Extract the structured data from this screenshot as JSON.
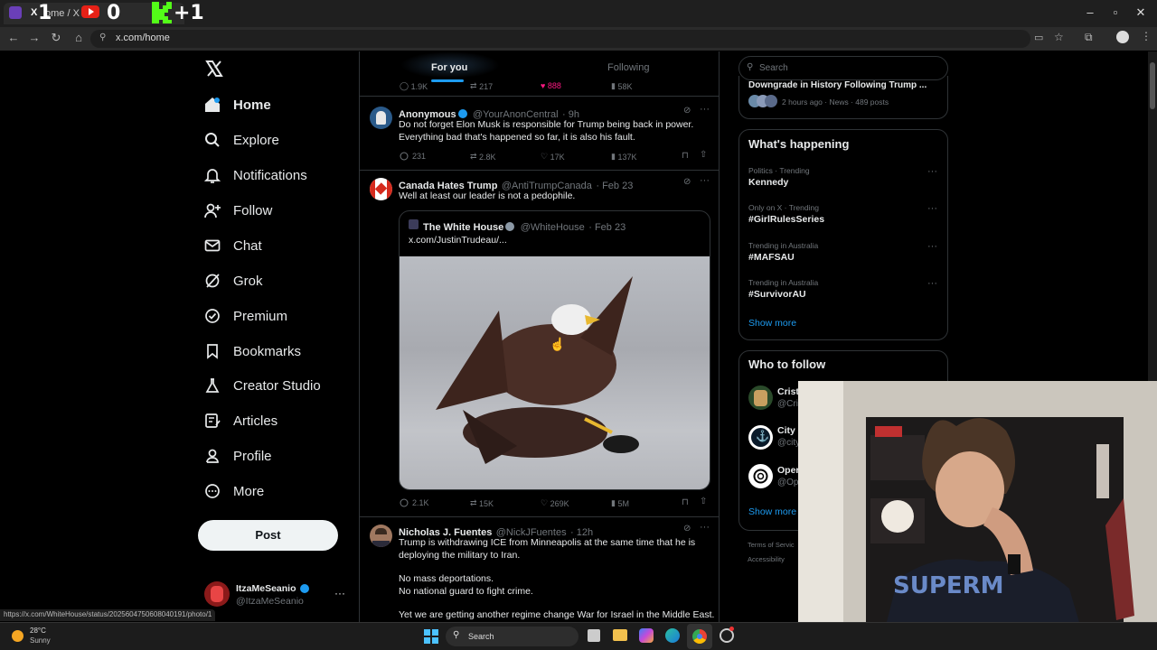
{
  "browser": {
    "tab_title": "ome / X",
    "scores": [
      "1",
      "0",
      "+1"
    ],
    "url": "x.com/home",
    "status_url": "https://x.com/WhiteHouse/status/2025604750608040191/photo/1"
  },
  "nav": {
    "items": [
      {
        "label": "Home",
        "icon": "home-icon"
      },
      {
        "label": "Explore",
        "icon": "search-icon"
      },
      {
        "label": "Notifications",
        "icon": "bell-icon"
      },
      {
        "label": "Follow",
        "icon": "person-plus-icon"
      },
      {
        "label": "Chat",
        "icon": "mail-icon"
      },
      {
        "label": "Grok",
        "icon": "grok-icon"
      },
      {
        "label": "Premium",
        "icon": "verified-badge-icon"
      },
      {
        "label": "Bookmarks",
        "icon": "bookmark-icon"
      },
      {
        "label": "Creator Studio",
        "icon": "flask-icon"
      },
      {
        "label": "Articles",
        "icon": "article-icon"
      },
      {
        "label": "Profile",
        "icon": "person-icon"
      },
      {
        "label": "More",
        "icon": "more-circle-icon"
      }
    ],
    "post_label": "Post",
    "account": {
      "name": "ItzaMeSeanio",
      "handle": "@ItzaMeSeanio"
    }
  },
  "feed": {
    "tabs": [
      "For you",
      "Following"
    ],
    "prev_actions": [
      "1.9K",
      "217",
      "888",
      "58K"
    ],
    "tweets": [
      {
        "name": "Anonymous",
        "handle": "@YourAnonCentral",
        "time": "· 9h",
        "text1": "Do not forget Elon Musk is responsible for Trump being back in power.",
        "text2": "Everything bad that's happened so far, it is also his fault.",
        "replies": "231",
        "reposts": "2.8K",
        "likes": "17K",
        "views": "137K"
      },
      {
        "name": "Canada Hates Trump",
        "handle": "@AntiTrumpCanada",
        "time": "· Feb 23",
        "text1": "Well at least our leader is not a pedophile.",
        "quote": {
          "name": "The White House",
          "handle": "@WhiteHouse",
          "time": "· Feb 23",
          "text": "x.com/JustinTrudeau/..."
        },
        "replies": "2.1K",
        "reposts": "15K",
        "likes": "269K",
        "views": "5M"
      },
      {
        "name": "Nicholas J. Fuentes",
        "handle": "@NickJFuentes",
        "time": "· 12h",
        "text1": "Trump is withdrawing ICE from Minneapolis at the same time that he is",
        "text2": "deploying the military to Iran.",
        "text3": "No mass deportations.",
        "text4": "No national guard to fight crime.",
        "text5": "Yet we are getting another regime change War for Israel in the Middle East."
      }
    ]
  },
  "right": {
    "search_placeholder": "Search",
    "news_title": "Downgrade in History Following Trump ...",
    "news_meta": "2 hours ago · News · 489 posts",
    "happening_title": "What's happening",
    "trends": [
      {
        "meta": "Politics · Trending",
        "name": "Kennedy"
      },
      {
        "meta": "Only on X · Trending",
        "name": "#GirlRulesSeries"
      },
      {
        "meta": "Trending in Australia",
        "name": "#MAFSAU"
      },
      {
        "meta": "Trending in Australia",
        "name": "#SurvivorAU"
      }
    ],
    "show_more": "Show more",
    "who_title": "Who to follow",
    "follow": [
      {
        "name": "Crist",
        "handle": "@Cri"
      },
      {
        "name": "City",
        "handle": "@city"
      },
      {
        "name": "Oper",
        "handle": "@Op"
      }
    ],
    "show_more2": "Show more",
    "footer1": "Terms of Servic",
    "footer2": "Accessibility"
  },
  "taskbar": {
    "temp": "28°C",
    "weather": "Sunny",
    "search": "Search"
  }
}
